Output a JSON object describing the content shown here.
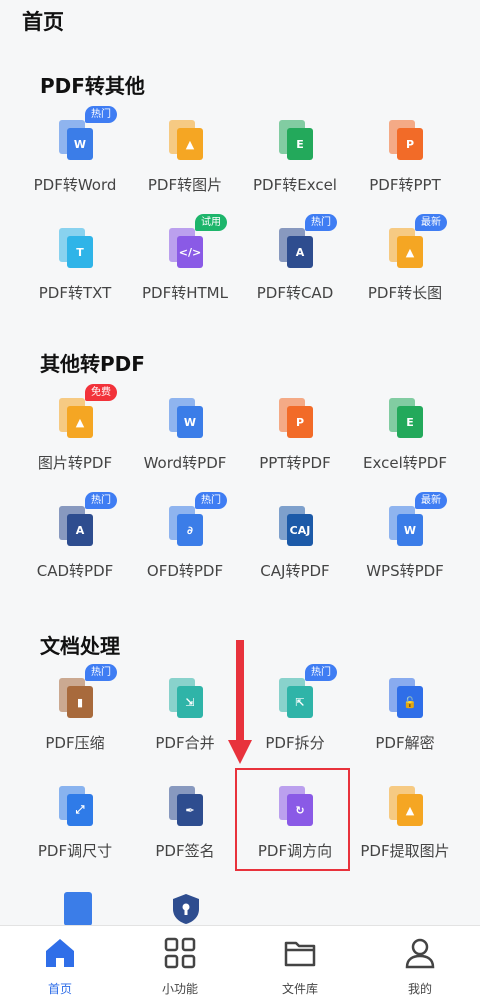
{
  "page_title": "首页",
  "sections": [
    {
      "title": "PDF转其他",
      "items": [
        {
          "label": "PDF转Word",
          "icon": "word-icon",
          "glyph": "W",
          "color": "#3b7de8",
          "badge": "热门",
          "badge_color": "blue"
        },
        {
          "label": "PDF转图片",
          "icon": "image-icon",
          "glyph": "▲",
          "color": "#f5a623",
          "badge": "",
          "badge_color": ""
        },
        {
          "label": "PDF转Excel",
          "icon": "excel-icon",
          "glyph": "E",
          "color": "#23a95b",
          "badge": "",
          "badge_color": ""
        },
        {
          "label": "PDF转PPT",
          "icon": "ppt-icon",
          "glyph": "P",
          "color": "#f26b28",
          "badge": "",
          "badge_color": ""
        },
        {
          "label": "PDF转TXT",
          "icon": "txt-icon",
          "glyph": "T",
          "color": "#2fb4e8",
          "badge": "",
          "badge_color": ""
        },
        {
          "label": "PDF转HTML",
          "icon": "html-icon",
          "glyph": "</>",
          "color": "#8a5ae6",
          "badge": "试用",
          "badge_color": "green"
        },
        {
          "label": "PDF转CAD",
          "icon": "cad-icon",
          "glyph": "A",
          "color": "#2e4d8f",
          "badge": "热门",
          "badge_color": "blue"
        },
        {
          "label": "PDF转长图",
          "icon": "long-image-icon",
          "glyph": "▲",
          "color": "#f5a623",
          "badge": "最新",
          "badge_color": "blue"
        }
      ]
    },
    {
      "title": "其他转PDF",
      "items": [
        {
          "label": "图片转PDF",
          "icon": "image-icon",
          "glyph": "▲",
          "color": "#f5a623",
          "badge": "免费",
          "badge_color": "red"
        },
        {
          "label": "Word转PDF",
          "icon": "word-icon",
          "glyph": "W",
          "color": "#3b7de8",
          "badge": "",
          "badge_color": ""
        },
        {
          "label": "PPT转PDF",
          "icon": "ppt-icon",
          "glyph": "P",
          "color": "#f26b28",
          "badge": "",
          "badge_color": ""
        },
        {
          "label": "Excel转PDF",
          "icon": "excel-icon",
          "glyph": "E",
          "color": "#23a95b",
          "badge": "",
          "badge_color": ""
        },
        {
          "label": "CAD转PDF",
          "icon": "cad-icon",
          "glyph": "A",
          "color": "#2e4d8f",
          "badge": "热门",
          "badge_color": "blue"
        },
        {
          "label": "OFD转PDF",
          "icon": "ofd-icon",
          "glyph": "∂",
          "color": "#3b7de8",
          "badge": "热门",
          "badge_color": "blue"
        },
        {
          "label": "CAJ转PDF",
          "icon": "caj-icon",
          "glyph": "CAJ",
          "color": "#1c5aa8",
          "badge": "",
          "badge_color": ""
        },
        {
          "label": "WPS转PDF",
          "icon": "wps-icon",
          "glyph": "W",
          "color": "#3b7de8",
          "badge": "最新",
          "badge_color": "blue"
        }
      ]
    },
    {
      "title": "文档处理",
      "items": [
        {
          "label": "PDF压缩",
          "icon": "compress-icon",
          "glyph": "▮",
          "color": "#a86a3c",
          "badge": "热门",
          "badge_color": "blue"
        },
        {
          "label": "PDF合并",
          "icon": "merge-icon",
          "glyph": "⇲",
          "color": "#2fb4a8",
          "badge": "",
          "badge_color": ""
        },
        {
          "label": "PDF拆分",
          "icon": "split-icon",
          "glyph": "⇱",
          "color": "#2fb4a8",
          "badge": "热门",
          "badge_color": "blue"
        },
        {
          "label": "PDF解密",
          "icon": "unlock-icon",
          "glyph": "🔓",
          "color": "#2f6ee8",
          "badge": "",
          "badge_color": ""
        },
        {
          "label": "PDF调尺寸",
          "icon": "resize-icon",
          "glyph": "⤢",
          "color": "#2f7be8",
          "badge": "",
          "badge_color": ""
        },
        {
          "label": "PDF签名",
          "icon": "pen-icon",
          "glyph": "✒",
          "color": "#2e4d8f",
          "badge": "",
          "badge_color": ""
        },
        {
          "label": "PDF调方向",
          "icon": "rotate-icon",
          "glyph": "↻",
          "color": "#8a5ae6",
          "badge": "",
          "badge_color": ""
        },
        {
          "label": "PDF提取图片",
          "icon": "extract-image-icon",
          "glyph": "▲",
          "color": "#f5a623",
          "badge": "",
          "badge_color": ""
        }
      ]
    }
  ],
  "nav": [
    {
      "label": "首页",
      "icon": "home-icon",
      "active": true
    },
    {
      "label": "小功能",
      "icon": "grid-icon",
      "active": false
    },
    {
      "label": "文件库",
      "icon": "folder-icon",
      "active": false
    },
    {
      "label": "我的",
      "icon": "user-icon",
      "active": false
    }
  ]
}
